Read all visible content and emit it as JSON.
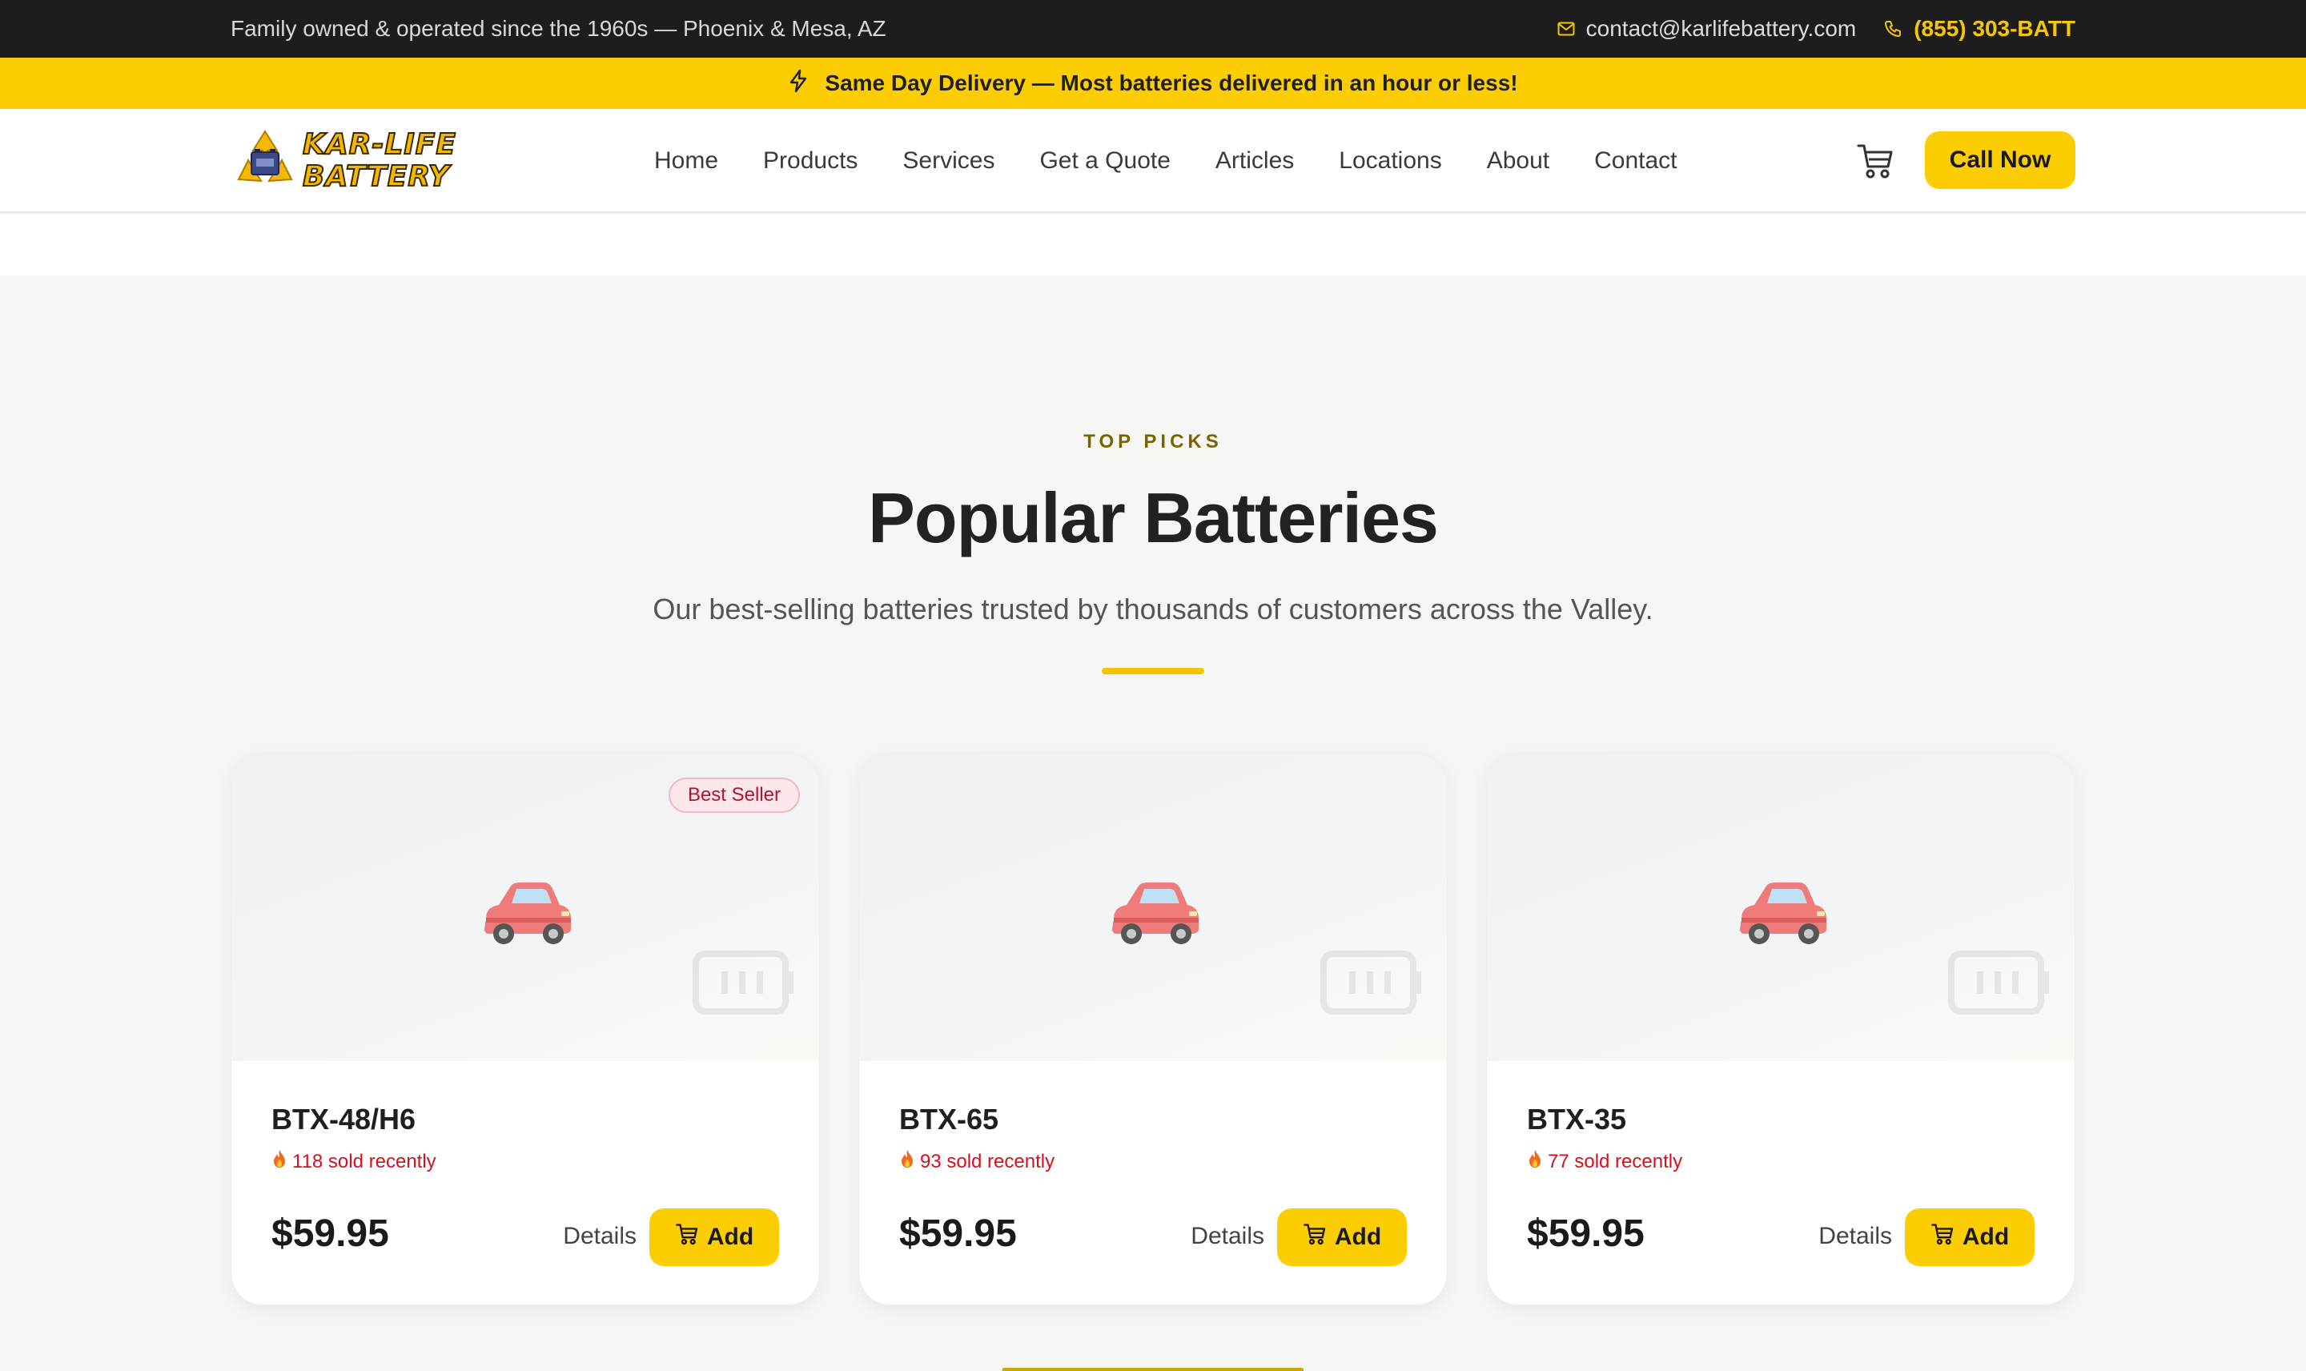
{
  "topbar": {
    "tagline": "Family owned & operated since the 1960s — Phoenix & Mesa, AZ",
    "email": "contact@karlifebattery.com",
    "phone": "(855) 303-BATT"
  },
  "announcement": {
    "text": "Same Day Delivery — Most batteries delivered in an hour or less!"
  },
  "header": {
    "logo_line1": "KAR-LIFE",
    "logo_line2": "BATTERY",
    "nav": [
      "Home",
      "Products",
      "Services",
      "Get a Quote",
      "Articles",
      "Locations",
      "About",
      "Contact"
    ],
    "cta": "Call Now"
  },
  "section": {
    "eyebrow": "TOP PICKS",
    "title": "Popular Batteries",
    "subtitle": "Our best-selling batteries trusted by thousands of customers across the Valley."
  },
  "products": [
    {
      "badge": "Best Seller",
      "name": "BTX-48/H6",
      "sold": "118 sold recently",
      "price": "$59.95",
      "details": "Details",
      "add": "Add"
    },
    {
      "badge": "",
      "name": "BTX-65",
      "sold": "93 sold recently",
      "price": "$59.95",
      "details": "Details",
      "add": "Add"
    },
    {
      "badge": "",
      "name": "BTX-35",
      "sold": "77 sold recently",
      "price": "$59.95",
      "details": "Details",
      "add": "Add"
    }
  ],
  "colors": {
    "accent": "#fccd00",
    "topbar": "#1d1d1d",
    "sold": "#d1121e",
    "badge_bg": "#fde7ea"
  }
}
